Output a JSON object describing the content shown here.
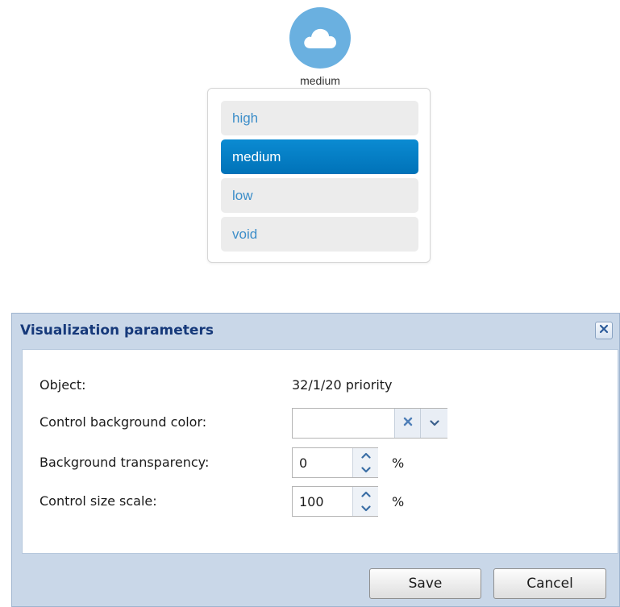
{
  "widget": {
    "icon": "cloud-icon",
    "icon_color": "#6ab0e0",
    "caption": "medium",
    "options": [
      {
        "label": "high",
        "selected": false
      },
      {
        "label": "medium",
        "selected": true
      },
      {
        "label": "low",
        "selected": false
      },
      {
        "label": "void",
        "selected": false
      }
    ],
    "selected_color": "#0a84c9"
  },
  "dialog": {
    "title": "Visualization parameters",
    "close_icon": "close-icon",
    "object_label": "Object:",
    "object_value": "32/1/20 priority",
    "bg_color_label": "Control background color:",
    "bg_color_value": "",
    "transparency_label": "Background transparency:",
    "transparency_value": "0",
    "transparency_unit": "%",
    "scale_label": "Control size scale:",
    "scale_value": "100",
    "scale_unit": "%",
    "save_label": "Save",
    "cancel_label": "Cancel"
  }
}
